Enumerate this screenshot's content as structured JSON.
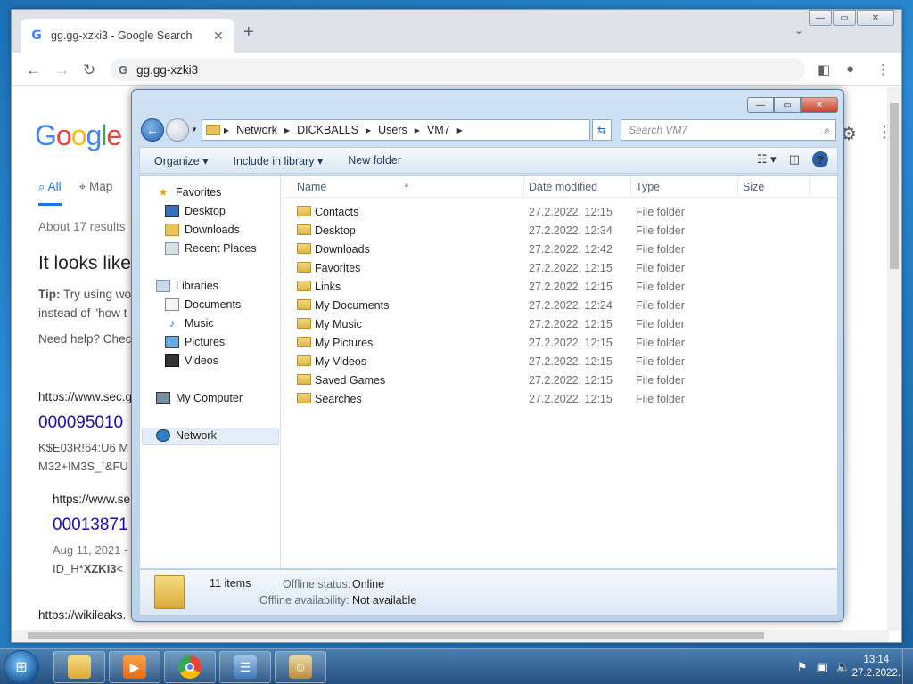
{
  "chrome": {
    "tab_title": "gg.gg-xzki3 - Google Search",
    "tab_close": "✕",
    "new_tab": "+",
    "address": "gg.gg-xzki3",
    "win_min": "—",
    "win_max": "▭",
    "win_close": "✕"
  },
  "google": {
    "logo": "Google",
    "tab_all": "All",
    "tab_maps": "Map",
    "about": "About 17 results",
    "looks_like": "It looks like",
    "tip_label": "Tip:",
    "tip_text": " Try using wo",
    "tip_line2": "instead of \"how t",
    "need_help": "Need help? Chec",
    "r1_url": "https://www.sec.g",
    "r1_title": "000095010",
    "r1_snip1": "K$E03R!64:U6 M",
    "r1_snip2": "M32+!M3S_`&FU",
    "r2_url": "https://www.se",
    "r2_title": "00013871",
    "r2_date": "Aug 11, 2021 -",
    "r2_snip_pre": "ID_H*",
    "r2_snip_bold": "XZKI3",
    "r2_snip_post": "<",
    "r3_url": "https://wikileaks."
  },
  "explorer": {
    "breadcrumb": [
      "Network",
      "DICKBALLS",
      "Users",
      "VM7"
    ],
    "search_placeholder": "Search VM7",
    "toolbar": {
      "organize": "Organize ▾",
      "include": "Include in library ▾",
      "new_folder": "New folder"
    },
    "nav": {
      "favorites": "Favorites",
      "desktop": "Desktop",
      "downloads": "Downloads",
      "recent": "Recent Places",
      "libraries": "Libraries",
      "documents": "Documents",
      "music": "Music",
      "pictures": "Pictures",
      "videos": "Videos",
      "my_computer": "My Computer",
      "network": "Network"
    },
    "columns": {
      "name": "Name",
      "date": "Date modified",
      "type": "Type",
      "size": "Size"
    },
    "files": [
      {
        "name": "Contacts",
        "date": "27.2.2022. 12:15",
        "type": "File folder"
      },
      {
        "name": "Desktop",
        "date": "27.2.2022. 12:34",
        "type": "File folder"
      },
      {
        "name": "Downloads",
        "date": "27.2.2022. 12:42",
        "type": "File folder"
      },
      {
        "name": "Favorites",
        "date": "27.2.2022. 12:15",
        "type": "File folder"
      },
      {
        "name": "Links",
        "date": "27.2.2022. 12:15",
        "type": "File folder"
      },
      {
        "name": "My Documents",
        "date": "27.2.2022. 12:24",
        "type": "File folder"
      },
      {
        "name": "My Music",
        "date": "27.2.2022. 12:15",
        "type": "File folder"
      },
      {
        "name": "My Pictures",
        "date": "27.2.2022. 12:15",
        "type": "File folder"
      },
      {
        "name": "My Videos",
        "date": "27.2.2022. 12:15",
        "type": "File folder"
      },
      {
        "name": "Saved Games",
        "date": "27.2.2022. 12:15",
        "type": "File folder"
      },
      {
        "name": "Searches",
        "date": "27.2.2022. 12:15",
        "type": "File folder"
      }
    ],
    "details": {
      "count": "11 items",
      "offline_status_label": "Offline status:",
      "offline_status": "Online",
      "offline_avail_label": "Offline availability:",
      "offline_avail": "Not available"
    }
  },
  "taskbar": {
    "time": "13:14",
    "date": "27.2.2022."
  }
}
